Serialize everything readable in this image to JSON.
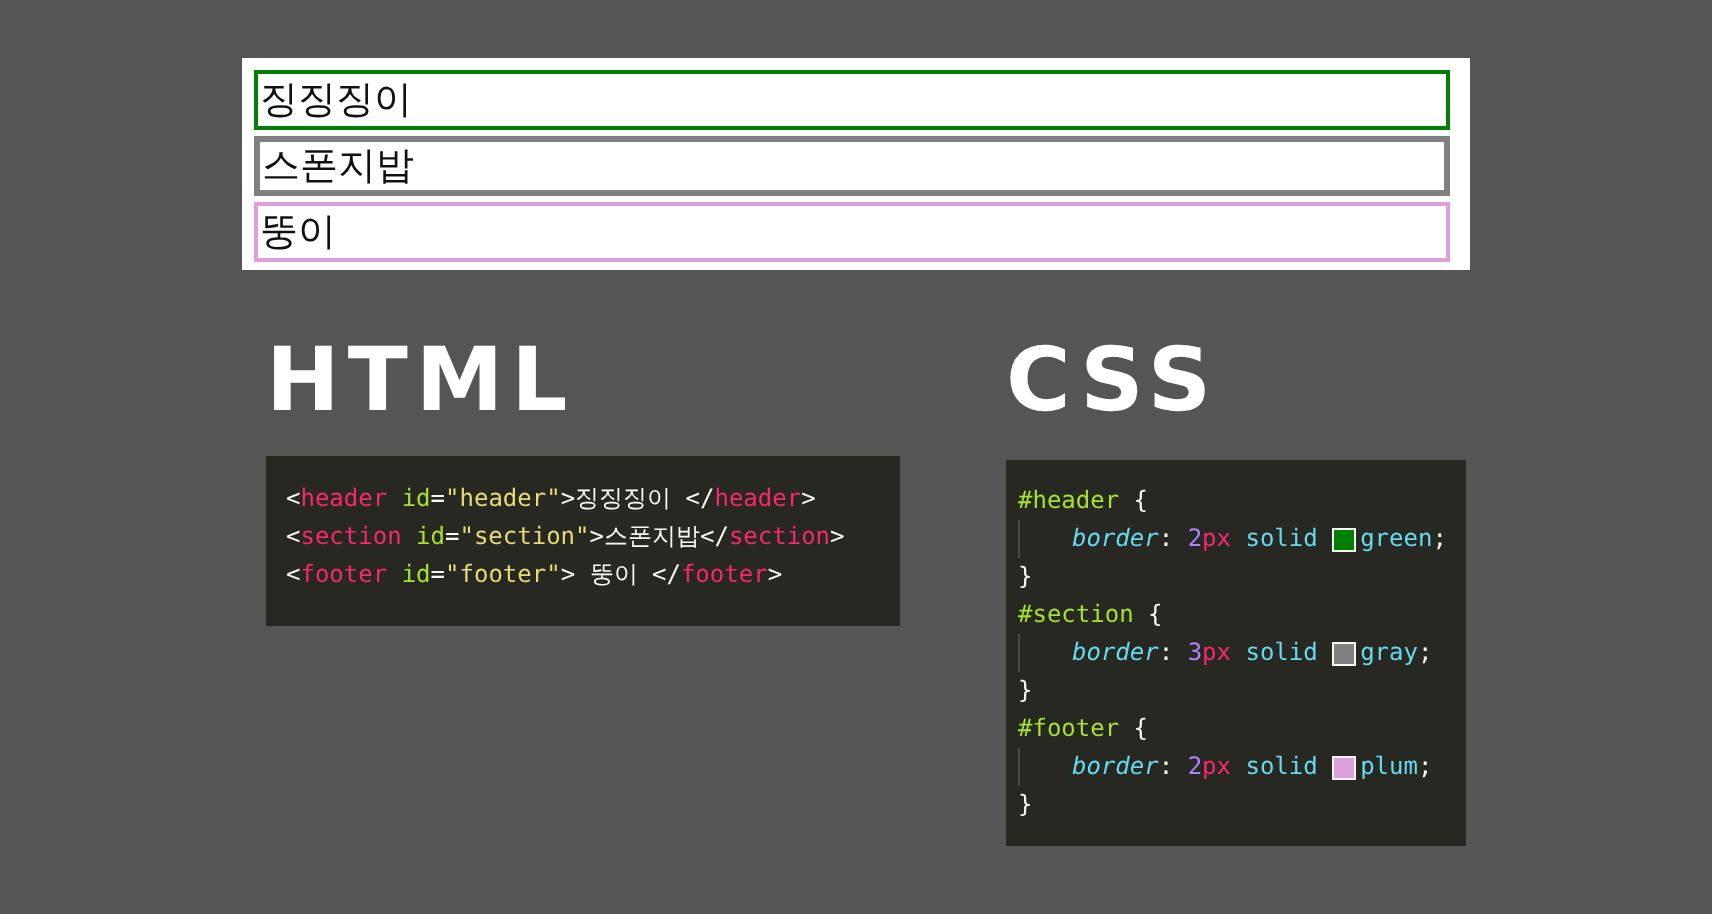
{
  "demo_boxes": [
    {
      "text": "징징징이",
      "color": "#008000",
      "kind": "thin"
    },
    {
      "text": "스폰지밥",
      "color": "#808080",
      "kind": "thick"
    },
    {
      "text": "뚱이",
      "color": "#dda0dd",
      "kind": "thin"
    }
  ],
  "html": {
    "heading": "HTML",
    "lines": [
      {
        "kind": "plain",
        "tokens": [
          {
            "kind": "punct",
            "text": "<"
          },
          {
            "kind": "tag",
            "text": "header"
          },
          {
            "kind": "attr",
            "text": " id"
          },
          {
            "kind": "punct",
            "text": "="
          },
          {
            "kind": "string",
            "text": "\"header\""
          },
          {
            "kind": "punct",
            "text": ">"
          },
          {
            "kind": "text",
            "text": "징징징이 "
          },
          {
            "kind": "punct",
            "text": "</"
          },
          {
            "kind": "tag",
            "text": "header"
          },
          {
            "kind": "punct",
            "text": ">"
          }
        ]
      },
      {
        "kind": "plain",
        "tokens": [
          {
            "kind": "punct",
            "text": "<"
          },
          {
            "kind": "tag",
            "text": "section"
          },
          {
            "kind": "attr",
            "text": " id"
          },
          {
            "kind": "punct",
            "text": "="
          },
          {
            "kind": "string",
            "text": "\"section\""
          },
          {
            "kind": "punct",
            "text": ">"
          },
          {
            "kind": "text",
            "text": "스폰지밥"
          },
          {
            "kind": "punct",
            "text": "</"
          },
          {
            "kind": "tag",
            "text": "section"
          },
          {
            "kind": "punct",
            "text": ">"
          }
        ]
      },
      {
        "kind": "plain",
        "tokens": [
          {
            "kind": "punct",
            "text": "<"
          },
          {
            "kind": "tag",
            "text": "footer"
          },
          {
            "kind": "attr",
            "text": " id"
          },
          {
            "kind": "punct",
            "text": "="
          },
          {
            "kind": "string",
            "text": "\"footer\""
          },
          {
            "kind": "punct",
            "text": ">"
          },
          {
            "kind": "text",
            "text": " 뚱이 "
          },
          {
            "kind": "punct",
            "text": "</"
          },
          {
            "kind": "tag",
            "text": "footer"
          },
          {
            "kind": "punct",
            "text": ">"
          }
        ]
      }
    ]
  },
  "css": {
    "heading": "CSS",
    "lines": [
      {
        "kind": "plain",
        "tokens": [
          {
            "kind": "selector",
            "text": "#header"
          },
          {
            "kind": "punct",
            "text": " {"
          }
        ]
      },
      {
        "kind": "declaration",
        "tokens": [
          {
            "kind": "property",
            "text": "border"
          },
          {
            "kind": "punct",
            "text": ": "
          },
          {
            "kind": "number",
            "text": "2"
          },
          {
            "kind": "unit",
            "text": "px"
          },
          {
            "kind": "keyword",
            "text": " solid "
          },
          {
            "kind": "swatch",
            "color": "#008000"
          },
          {
            "kind": "keyword",
            "text": "green"
          },
          {
            "kind": "punct",
            "text": ";"
          }
        ]
      },
      {
        "kind": "plain",
        "tokens": [
          {
            "kind": "punct",
            "text": "}"
          }
        ]
      },
      {
        "kind": "plain",
        "tokens": [
          {
            "kind": "selector",
            "text": "#section"
          },
          {
            "kind": "punct",
            "text": " {"
          }
        ]
      },
      {
        "kind": "declaration",
        "tokens": [
          {
            "kind": "property",
            "text": "border"
          },
          {
            "kind": "punct",
            "text": ": "
          },
          {
            "kind": "number",
            "text": "3"
          },
          {
            "kind": "unit",
            "text": "px"
          },
          {
            "kind": "keyword",
            "text": " solid "
          },
          {
            "kind": "swatch",
            "color": "#808080"
          },
          {
            "kind": "keyword",
            "text": "gray"
          },
          {
            "kind": "punct",
            "text": ";"
          }
        ]
      },
      {
        "kind": "plain",
        "tokens": [
          {
            "kind": "punct",
            "text": "}"
          }
        ]
      },
      {
        "kind": "plain",
        "tokens": [
          {
            "kind": "selector",
            "text": "#footer"
          },
          {
            "kind": "punct",
            "text": " {"
          }
        ]
      },
      {
        "kind": "declaration",
        "tokens": [
          {
            "kind": "property",
            "text": "border"
          },
          {
            "kind": "punct",
            "text": ": "
          },
          {
            "kind": "number",
            "text": "2"
          },
          {
            "kind": "unit",
            "text": "px"
          },
          {
            "kind": "keyword",
            "text": " solid "
          },
          {
            "kind": "swatch",
            "color": "#dda0dd"
          },
          {
            "kind": "keyword",
            "text": "plum"
          },
          {
            "kind": "punct",
            "text": ";"
          }
        ]
      },
      {
        "kind": "plain",
        "tokens": [
          {
            "kind": "punct",
            "text": "}"
          }
        ]
      }
    ]
  }
}
